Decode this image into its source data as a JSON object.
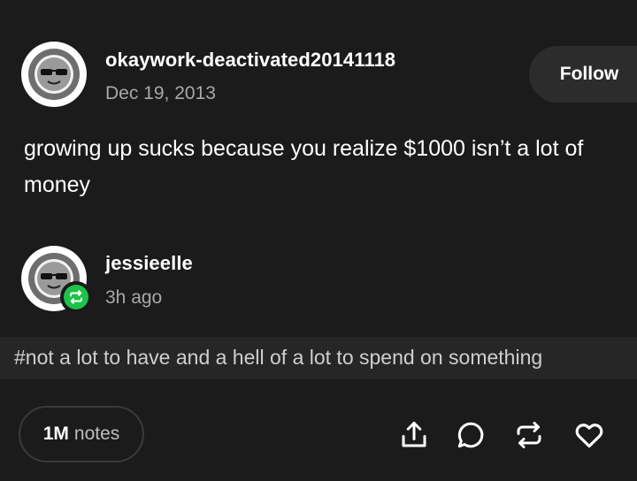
{
  "original_post": {
    "blog_name": "okaywork-deactivated20141118",
    "date": "Dec 19, 2013",
    "avatar_icon": "sunglasses-face-avatar",
    "follow_label": "Follow",
    "body_text": "growing up sucks because you realize $1000 isn’t a lot of money"
  },
  "reblog": {
    "blog_name": "jessieelle",
    "time_ago": "3h ago",
    "avatar_icon": "sunglasses-face-avatar",
    "badge_icon": "reblog-icon",
    "badge_color": "#1ec34a"
  },
  "tags": [
    "#not a lot to have and a hell of a lot to spend on something"
  ],
  "footer": {
    "notes_count": "1M",
    "notes_label": "notes",
    "actions": [
      "share-icon",
      "reply-icon",
      "reblog-icon",
      "heart-icon"
    ]
  },
  "colors": {
    "background": "#1b1b1b",
    "tag_bar": "#262626",
    "muted_text": "#a8a8a8"
  }
}
